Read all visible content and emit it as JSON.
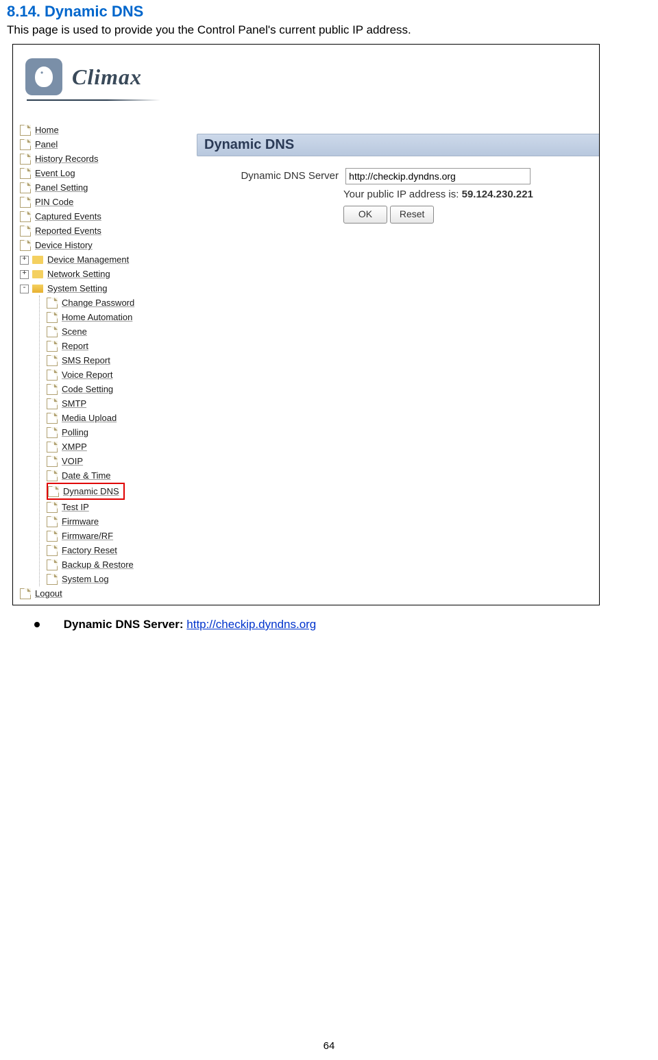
{
  "heading": "8.14. Dynamic DNS",
  "intro": "This page is used to provide you the Control Panel's current public IP address.",
  "logo_text": "Climax",
  "tree": {
    "home": "Home",
    "panel": "Panel",
    "history_records": "History Records",
    "event_log": "Event Log",
    "panel_setting": "Panel Setting",
    "pin_code": "PIN Code",
    "captured_events": "Captured Events",
    "reported_events": "Reported Events",
    "device_history": "Device History",
    "device_management": "Device Management",
    "network_setting": "Network Setting",
    "system_setting": "System Setting",
    "change_password": "Change Password",
    "home_automation": "Home Automation",
    "scene": "Scene",
    "report": "Report",
    "sms_report": "SMS Report",
    "voice_report": "Voice Report",
    "code_setting": "Code Setting",
    "smtp": "SMTP",
    "media_upload": "Media Upload",
    "polling": "Polling",
    "xmpp": "XMPP",
    "voip": "VOIP",
    "date_time": "Date & Time",
    "dynamic_dns": "Dynamic DNS",
    "test_ip": "Test IP",
    "firmware": "Firmware",
    "firmware_rf": "Firmware/RF",
    "factory_reset": "Factory Reset",
    "backup_restore": "Backup & Restore",
    "system_log": "System Log",
    "logout": "Logout"
  },
  "panel": {
    "title": "Dynamic DNS",
    "server_label": "Dynamic DNS Server",
    "server_value": "http://checkip.dyndns.org",
    "ip_label": "Your public IP address is: ",
    "ip_value": "59.124.230.221",
    "ok_label": "OK",
    "reset_label": "Reset"
  },
  "bullet": {
    "label": "Dynamic DNS Server: ",
    "link_text": "http://checkip.dyndns.org"
  },
  "page_number": "64"
}
